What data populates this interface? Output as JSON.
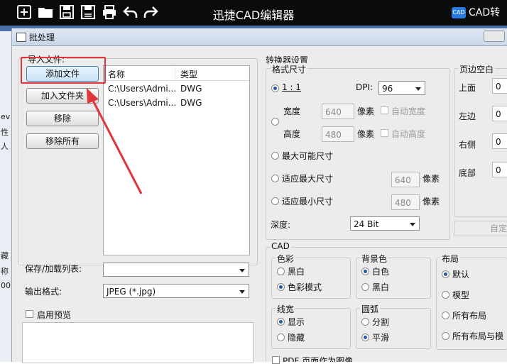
{
  "app": {
    "title": "迅捷CAD编辑器",
    "brand_badge": "CAD",
    "brand_text": "CAD转"
  },
  "toolbar": {
    "icons": [
      "new-icon",
      "open-folder-icon",
      "save-icon",
      "save-as-icon",
      "print-icon",
      "undo-icon",
      "redo-icon"
    ]
  },
  "left_strip": [
    "ev",
    "性",
    "人",
    "藏",
    "称",
    "00"
  ],
  "dialog": {
    "title": "批处理"
  },
  "import": {
    "group_title": "导入文件:",
    "add_file": "添加文件",
    "add_folder": "加入文件夹",
    "remove": "移除",
    "remove_all": "移除所有",
    "columns": [
      "名称",
      "类型"
    ],
    "rows": [
      {
        "name": "C:\\Users\\Admi...",
        "type": "DWG"
      },
      {
        "name": "C:\\Users\\Admi...",
        "type": "DWG"
      }
    ]
  },
  "save_list": {
    "label": "保存/加载列表:",
    "value": ""
  },
  "output": {
    "label": "输出格式:",
    "value": "JPEG (*.jpg)"
  },
  "preview": {
    "label": "启用预览"
  },
  "converter": {
    "title": "转换器设置",
    "format_size": {
      "title": "格式尺寸",
      "ratio_label": "1 : 1",
      "dpi_label": "DPI:",
      "dpi_value": "96",
      "width_label": "宽度",
      "width_value": "640",
      "height_label": "高度",
      "height_value": "480",
      "unit": "像素",
      "auto_width": "自动宽度",
      "auto_height": "自动高度",
      "max_possible": "最大可能尺寸",
      "fit_max": "适应最大尺寸",
      "fit_max_value": "640",
      "fit_min": "适应最小尺寸",
      "fit_min_value": "480",
      "depth_label": "深度:",
      "depth_value": "24 Bit"
    },
    "margins": {
      "title": "页边空白",
      "top": "上面",
      "top_value": "0",
      "left": "左边",
      "left_value": "0",
      "right": "右侧",
      "right_value": "0",
      "bottom": "底部",
      "bottom_value": "0",
      "custom_button": "自定"
    }
  },
  "cad": {
    "title": "CAD",
    "color": {
      "title": "色彩",
      "options": [
        "黑白",
        "色彩模式"
      ],
      "selected": 1
    },
    "background": {
      "title": "背景色",
      "options": [
        "白色",
        "黑白"
      ],
      "selected": 0
    },
    "layout": {
      "title": "布局",
      "options": [
        "默认",
        "模型",
        "所有布局",
        "所有布局与模"
      ],
      "selected": 0
    },
    "linewidth": {
      "title": "线宽",
      "options": [
        "显示",
        "隐藏"
      ],
      "selected": 0
    },
    "arc": {
      "title": "圆弧",
      "options": [
        "分割",
        "平滑"
      ],
      "selected": 1
    },
    "bottom_cut": "PDF 页面作为图像"
  },
  "colors": {
    "highlight": "#e0353b",
    "topbar": "#0b0b0b"
  }
}
